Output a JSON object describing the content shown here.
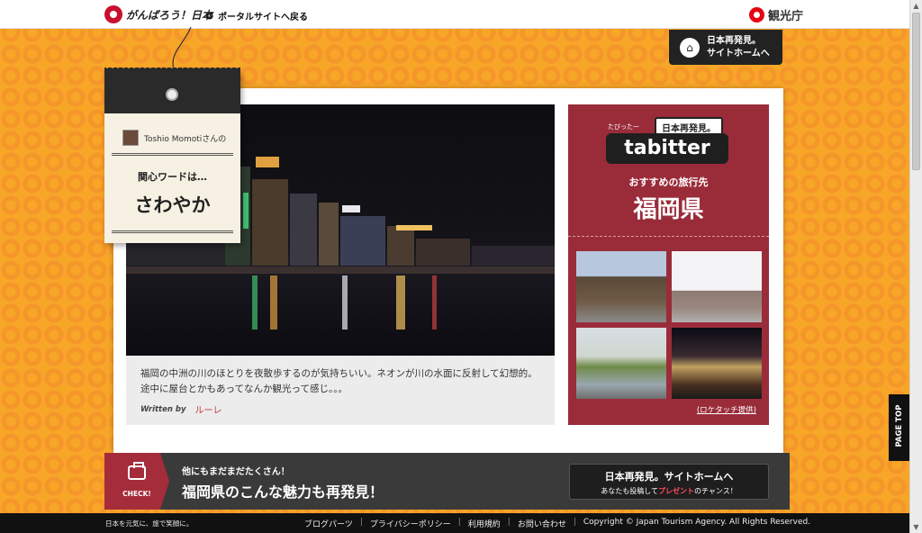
{
  "header": {
    "logo_text": "がんばろう！日本",
    "portal_link": "ポータルサイトへ戻る",
    "agency": "観光庁"
  },
  "site_home": {
    "line1": "日本再発見。",
    "line2": "サイトホームへ"
  },
  "tag": {
    "user_name": "Toshio Momotiさんの",
    "interest_label": "関心ワードは…",
    "interest_word": "さわやか"
  },
  "post": {
    "caption": "福岡の中洲の川のほとりを夜散歩するのが気持ちいい。ネオンが川の水面に反射して幻想的。途中に屋台とかもあってなんか観光って感じ。。。",
    "written_by": "Written by",
    "author": "ルーレ"
  },
  "tabitter": {
    "badge": "日本再発見。",
    "ruby": "たびったー",
    "logo": "tabitter",
    "recommend": "おすすめの旅行先",
    "prefecture": "福岡県",
    "credit": "(ロケタッチ提供)"
  },
  "cta": {
    "check": "CHECK!",
    "small": "他にもまだまだたくさん！",
    "big": "福岡県のこんな魅力も再発見！",
    "button_title": "日本再発見。サイトホームへ",
    "button_sub_pre": "あなたも投稿して",
    "button_sub_highlight": "プレゼント",
    "button_sub_post": "のチャンス！"
  },
  "footer": {
    "tagline": "日本を元気に、旅で笑顔に。",
    "links": [
      "ブログパーツ",
      "プライバシーポリシー",
      "利用規約",
      "お問い合わせ"
    ],
    "copyright": "Copyright © Japan Tourism Agency. All Rights Reserved."
  },
  "page_top": "PAGE TOP",
  "colors": {
    "background_orange": "#f7a628",
    "tabitter_red": "#9a2c3a",
    "cta_dark": "#3a3a3a"
  }
}
